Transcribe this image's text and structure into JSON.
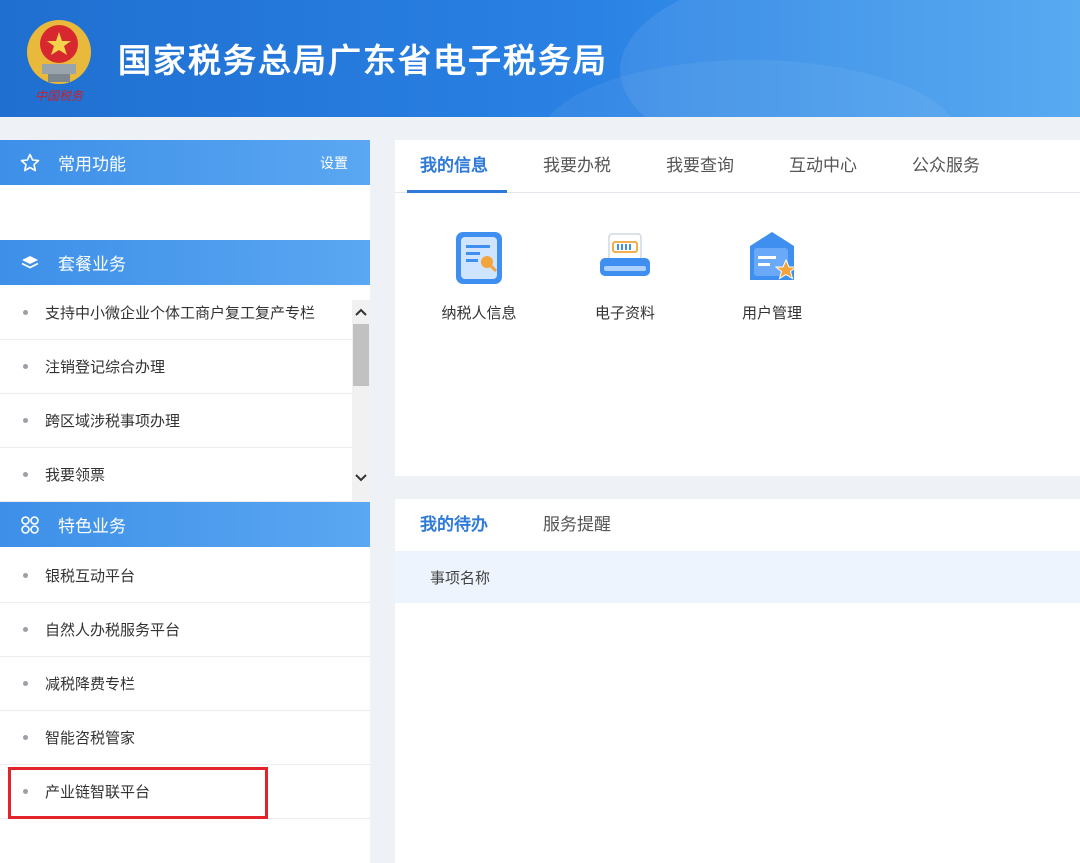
{
  "header": {
    "title": "国家税务总局广东省电子税务局",
    "emblem_text": "中国税务"
  },
  "sidebar": {
    "common": {
      "title": "常用功能",
      "setting": "设置"
    },
    "package": {
      "title": "套餐业务",
      "items": [
        {
          "label": "支持中小微企业个体工商户复工复产专栏"
        },
        {
          "label": "注销登记综合办理"
        },
        {
          "label": "跨区域涉税事项办理"
        },
        {
          "label": "我要领票"
        }
      ]
    },
    "featured": {
      "title": "特色业务",
      "items": [
        {
          "label": "银税互动平台"
        },
        {
          "label": "自然人办税服务平台"
        },
        {
          "label": "减税降费专栏"
        },
        {
          "label": "智能咨税管家"
        },
        {
          "label": "产业链智联平台"
        }
      ]
    }
  },
  "main": {
    "tabs": [
      {
        "label": "我的信息"
      },
      {
        "label": "我要办税"
      },
      {
        "label": "我要查询"
      },
      {
        "label": "互动中心"
      },
      {
        "label": "公众服务"
      }
    ],
    "services": [
      {
        "label": "纳税人信息",
        "icon": "document-search-icon"
      },
      {
        "label": "电子资料",
        "icon": "printer-barcode-icon"
      },
      {
        "label": "用户管理",
        "icon": "user-star-icon"
      }
    ]
  },
  "todo": {
    "tabs": [
      {
        "label": "我的待办"
      },
      {
        "label": "服务提醒"
      }
    ],
    "column_header": "事项名称"
  },
  "colors": {
    "brand_blue": "#2f7ad8",
    "header_blue": "#1f6fd0",
    "highlight_red": "#e2242a"
  }
}
